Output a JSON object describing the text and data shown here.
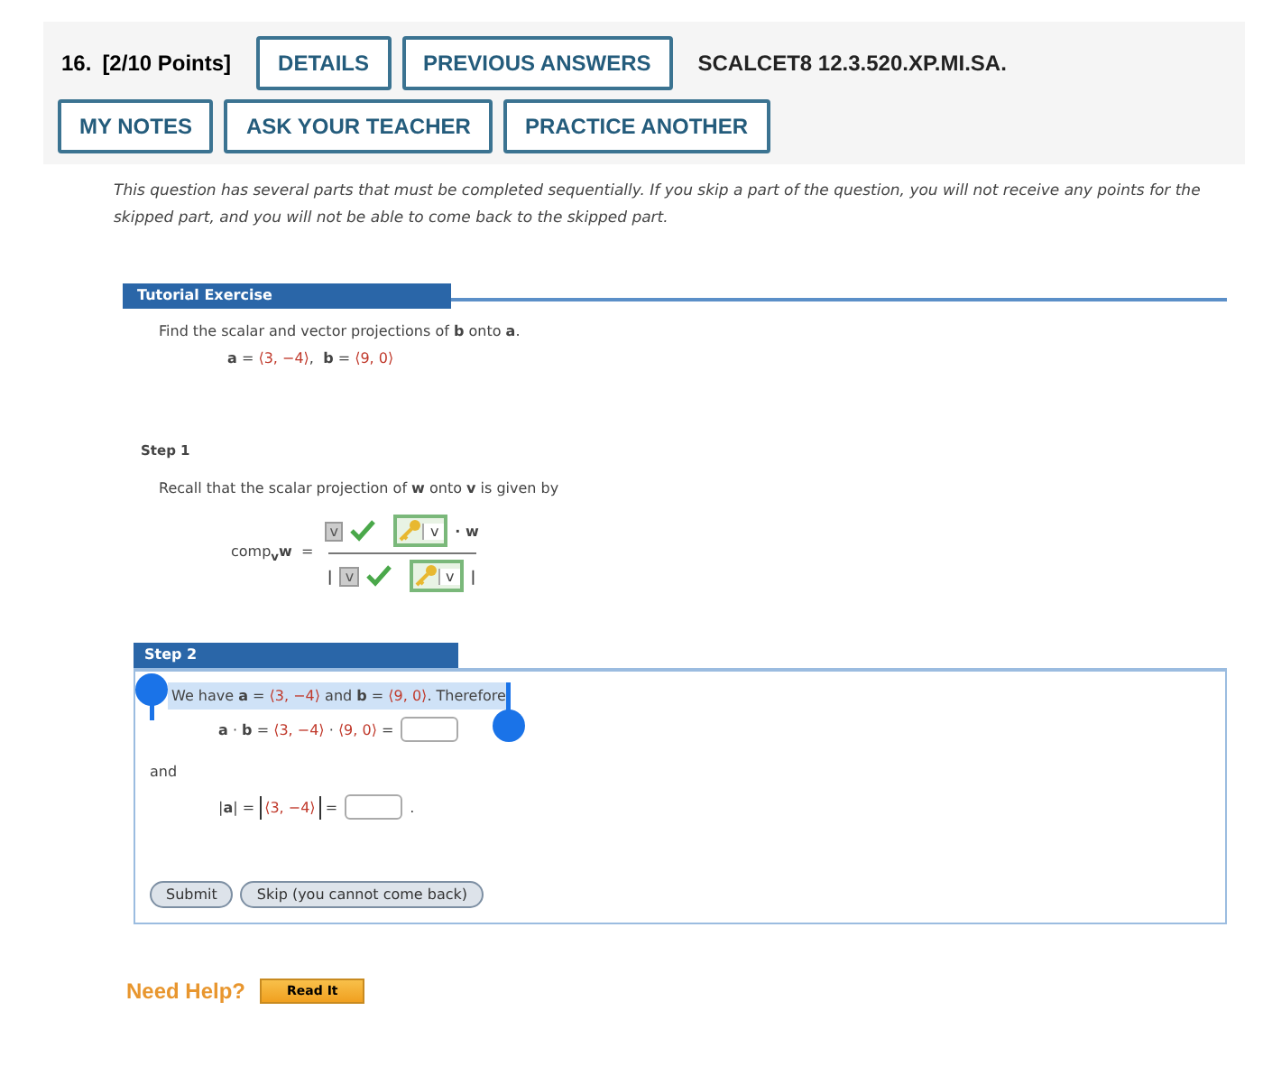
{
  "question": {
    "number": "16.",
    "points": "[2/10 Points]",
    "code": "SCALCET8 12.3.520.XP.MI.SA.",
    "top_buttons": [
      "DETAILS",
      "PREVIOUS ANSWERS"
    ],
    "bottom_buttons": [
      "MY NOTES",
      "ASK YOUR TEACHER",
      "PRACTICE ANOTHER"
    ]
  },
  "instructions": "This question has several parts that must be completed sequentially. If you skip a part of the question, you will not receive any points for the skipped part, and you will not be able to come back to the skipped part.",
  "tutorial": {
    "title": "Tutorial Exercise",
    "prompt": [
      {
        "kind": "text",
        "text": "Find the scalar and vector projections of "
      },
      {
        "kind": "bold",
        "text": "b"
      },
      {
        "kind": "text",
        "text": " onto "
      },
      {
        "kind": "bold",
        "text": "a"
      },
      {
        "kind": "text",
        "text": "."
      }
    ],
    "given": [
      {
        "kind": "bold",
        "text": "a"
      },
      {
        "kind": "text",
        "text": " = "
      },
      {
        "kind": "vec",
        "text": "⟨3, −4⟩"
      },
      {
        "kind": "text",
        "text": ",  "
      },
      {
        "kind": "bold",
        "text": "b"
      },
      {
        "kind": "text",
        "text": " = "
      },
      {
        "kind": "vec",
        "text": "⟨9, 0⟩"
      }
    ]
  },
  "step1": {
    "label": "Step 1",
    "text": [
      {
        "kind": "text",
        "text": "Recall that the scalar projection of "
      },
      {
        "kind": "bold",
        "text": "w"
      },
      {
        "kind": "text",
        "text": " onto "
      },
      {
        "kind": "bold",
        "text": "v"
      },
      {
        "kind": "text",
        "text": " is given by"
      }
    ],
    "lhs": [
      {
        "kind": "text",
        "text": "comp"
      },
      {
        "kind": "sub",
        "text": "v"
      },
      {
        "kind": "bold",
        "text": "w"
      },
      {
        "kind": "text",
        "text": "  ="
      }
    ],
    "numerator": {
      "answer": "v",
      "correct": true,
      "key": "v",
      "after": "· w"
    },
    "denominator": {
      "before": "|",
      "answer": "v",
      "correct": true,
      "key": "v",
      "after": "|"
    }
  },
  "step2": {
    "label": "Step 2",
    "intro_highlighted": true,
    "intro": [
      {
        "kind": "text",
        "text": "We have "
      },
      {
        "kind": "bold",
        "text": "a"
      },
      {
        "kind": "text",
        "text": " = "
      },
      {
        "kind": "vec",
        "text": "⟨3, −4⟩"
      },
      {
        "kind": "text",
        "text": " and "
      },
      {
        "kind": "bold",
        "text": "b"
      },
      {
        "kind": "text",
        "text": " = "
      },
      {
        "kind": "vec",
        "text": "⟨9, 0⟩"
      },
      {
        "kind": "text",
        "text": ". Therefore"
      }
    ],
    "eq1": [
      {
        "kind": "bold",
        "text": "a"
      },
      {
        "kind": "text",
        "text": " · "
      },
      {
        "kind": "bold",
        "text": "b"
      },
      {
        "kind": "text",
        "text": " = "
      },
      {
        "kind": "vec",
        "text": "⟨3, −4⟩"
      },
      {
        "kind": "text",
        "text": " · "
      },
      {
        "kind": "vec",
        "text": "⟨9, 0⟩"
      },
      {
        "kind": "text",
        "text": " ="
      },
      {
        "kind": "blank"
      }
    ],
    "and": "and",
    "eq2": [
      {
        "kind": "text",
        "text": "|"
      },
      {
        "kind": "bold",
        "text": "a"
      },
      {
        "kind": "text",
        "text": "| = "
      },
      {
        "kind": "norm",
        "text": "⟨3, −4⟩"
      },
      {
        "kind": "text",
        "text": " ="
      },
      {
        "kind": "blank"
      },
      {
        "kind": "text",
        "text": "."
      }
    ],
    "buttons": [
      "Submit",
      "Skip (you cannot come back)"
    ]
  },
  "help": {
    "label": "Need Help?",
    "buttons": [
      "Read It"
    ]
  }
}
